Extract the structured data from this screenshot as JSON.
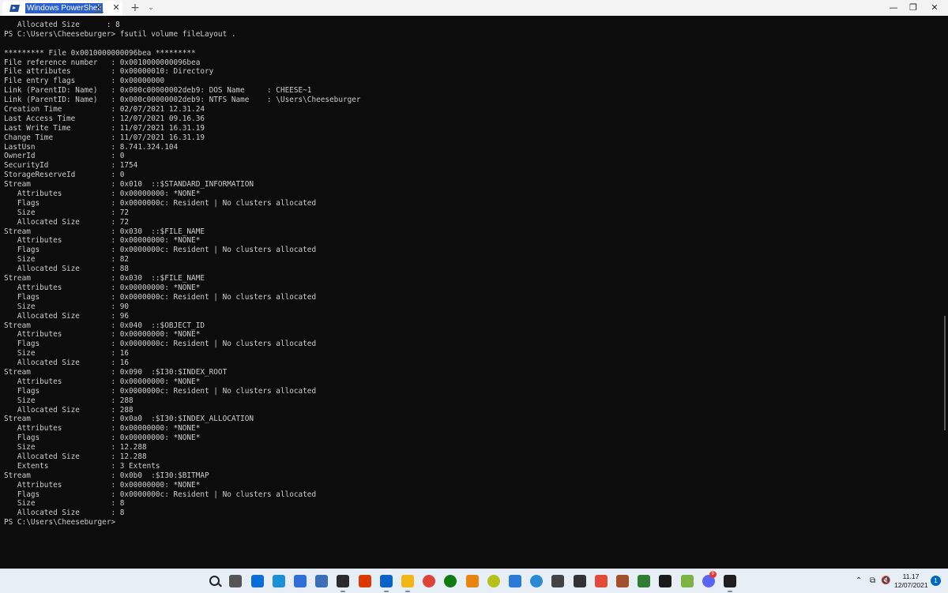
{
  "window": {
    "tab_title": "Windows PowerShell",
    "tab_close_glyph": "✕",
    "new_tab_glyph": "+",
    "dropdown_glyph": "⌄",
    "minimize_glyph": "—",
    "maximize_glyph": "❐",
    "close_glyph": "✕"
  },
  "terminal": {
    "lines": [
      "   Allocated Size      : 8",
      "PS C:\\Users\\Cheeseburger> fsutil volume fileLayout .",
      "",
      "********* File 0x0010000000096bea *********",
      "File reference number   : 0x0010000000096bea",
      "File attributes         : 0x00000010: Directory",
      "File entry flags        : 0x00000000",
      "Link (ParentID: Name)   : 0x000c00000002deb9: DOS Name     : CHEESE~1",
      "Link (ParentID: Name)   : 0x000c00000002deb9: NTFS Name    : \\Users\\Cheeseburger",
      "Creation Time           : 02/07/2021 12.31.24",
      "Last Access Time        : 12/07/2021 09.16.36",
      "Last Write Time         : 11/07/2021 16.31.19",
      "Change Time             : 11/07/2021 16.31.19",
      "LastUsn                 : 8.741.324.104",
      "OwnerId                 : 0",
      "SecurityId              : 1754",
      "StorageReserveId        : 0",
      "Stream                  : 0x010  ::$STANDARD_INFORMATION",
      "   Attributes           : 0x00000000: *NONE*",
      "   Flags                : 0x0000000c: Resident | No clusters allocated",
      "   Size                 : 72",
      "   Allocated Size       : 72",
      "Stream                  : 0x030  ::$FILE_NAME",
      "   Attributes           : 0x00000000: *NONE*",
      "   Flags                : 0x0000000c: Resident | No clusters allocated",
      "   Size                 : 82",
      "   Allocated Size       : 88",
      "Stream                  : 0x030  ::$FILE_NAME",
      "   Attributes           : 0x00000000: *NONE*",
      "   Flags                : 0x0000000c: Resident | No clusters allocated",
      "   Size                 : 90",
      "   Allocated Size       : 96",
      "Stream                  : 0x040  ::$OBJECT_ID",
      "   Attributes           : 0x00000000: *NONE*",
      "   Flags                : 0x0000000c: Resident | No clusters allocated",
      "   Size                 : 16",
      "   Allocated Size       : 16",
      "Stream                  : 0x090  :$I30:$INDEX_ROOT",
      "   Attributes           : 0x00000000: *NONE*",
      "   Flags                : 0x0000000c: Resident | No clusters allocated",
      "   Size                 : 288",
      "   Allocated Size       : 288",
      "Stream                  : 0x0a0  :$I30:$INDEX_ALLOCATION",
      "   Attributes           : 0x00000000: *NONE*",
      "   Flags                : 0x00000000: *NONE*",
      "   Size                 : 12.288",
      "   Allocated Size       : 12.288",
      "   Extents              : 3 Extents",
      "Stream                  : 0x0b0  :$I30:$BITMAP",
      "   Attributes           : 0x00000000: *NONE*",
      "   Flags                : 0x0000000c: Resident | No clusters allocated",
      "   Size                 : 8",
      "   Allocated Size       : 8",
      "PS C:\\Users\\Cheeseburger>"
    ]
  },
  "taskbar": {
    "icons": [
      {
        "name": "start-icon",
        "color": "#0067c0"
      },
      {
        "name": "search-icon",
        "color": "#222222"
      },
      {
        "name": "task-view-icon",
        "color": "#555555"
      },
      {
        "name": "widgets-icon",
        "color": "#0a6cd6"
      },
      {
        "name": "edge-icon",
        "color": "#1d8fd8"
      },
      {
        "name": "store-icon",
        "color": "#2f6fd6"
      },
      {
        "name": "settings-icon",
        "color": "#3b6fb6"
      },
      {
        "name": "terminal-app-icon",
        "color": "#2b2b2b"
      },
      {
        "name": "office-icon",
        "color": "#d83b01"
      },
      {
        "name": "mail-icon",
        "color": "#0a64c8"
      },
      {
        "name": "file-explorer-icon",
        "color": "#f2b619"
      },
      {
        "name": "chrome-icon",
        "color": "#db4437"
      },
      {
        "name": "xbox-icon",
        "color": "#107c10"
      },
      {
        "name": "search-everything-icon",
        "color": "#e8850c"
      },
      {
        "name": "lens-icon",
        "color": "#b6c21a"
      },
      {
        "name": "notes-icon",
        "color": "#2a7bd4"
      },
      {
        "name": "globe-icon",
        "color": "#2a8bd4"
      },
      {
        "name": "pen-icon",
        "color": "#444444"
      },
      {
        "name": "seven-zip-icon",
        "color": "#333333"
      },
      {
        "name": "paint-icon",
        "color": "#e24a3a"
      },
      {
        "name": "avatar-app-icon",
        "color": "#a0522d"
      },
      {
        "name": "monitor-icon",
        "color": "#2e7d32"
      },
      {
        "name": "cmd-icon",
        "color": "#1b1b1b"
      },
      {
        "name": "notepad-icon",
        "color": "#7cb342"
      },
      {
        "name": "discord-icon",
        "color": "#5865f2"
      },
      {
        "name": "powershell-taskbar-icon",
        "color": "#1f1f1f"
      }
    ],
    "discord_badge": "9",
    "tray": {
      "chevron_glyph": "⌃",
      "network_glyph": "⧉",
      "volume_glyph": "🔇"
    },
    "clock": {
      "time": "11.17",
      "date": "12/07/2021"
    },
    "notification_count": "1"
  }
}
